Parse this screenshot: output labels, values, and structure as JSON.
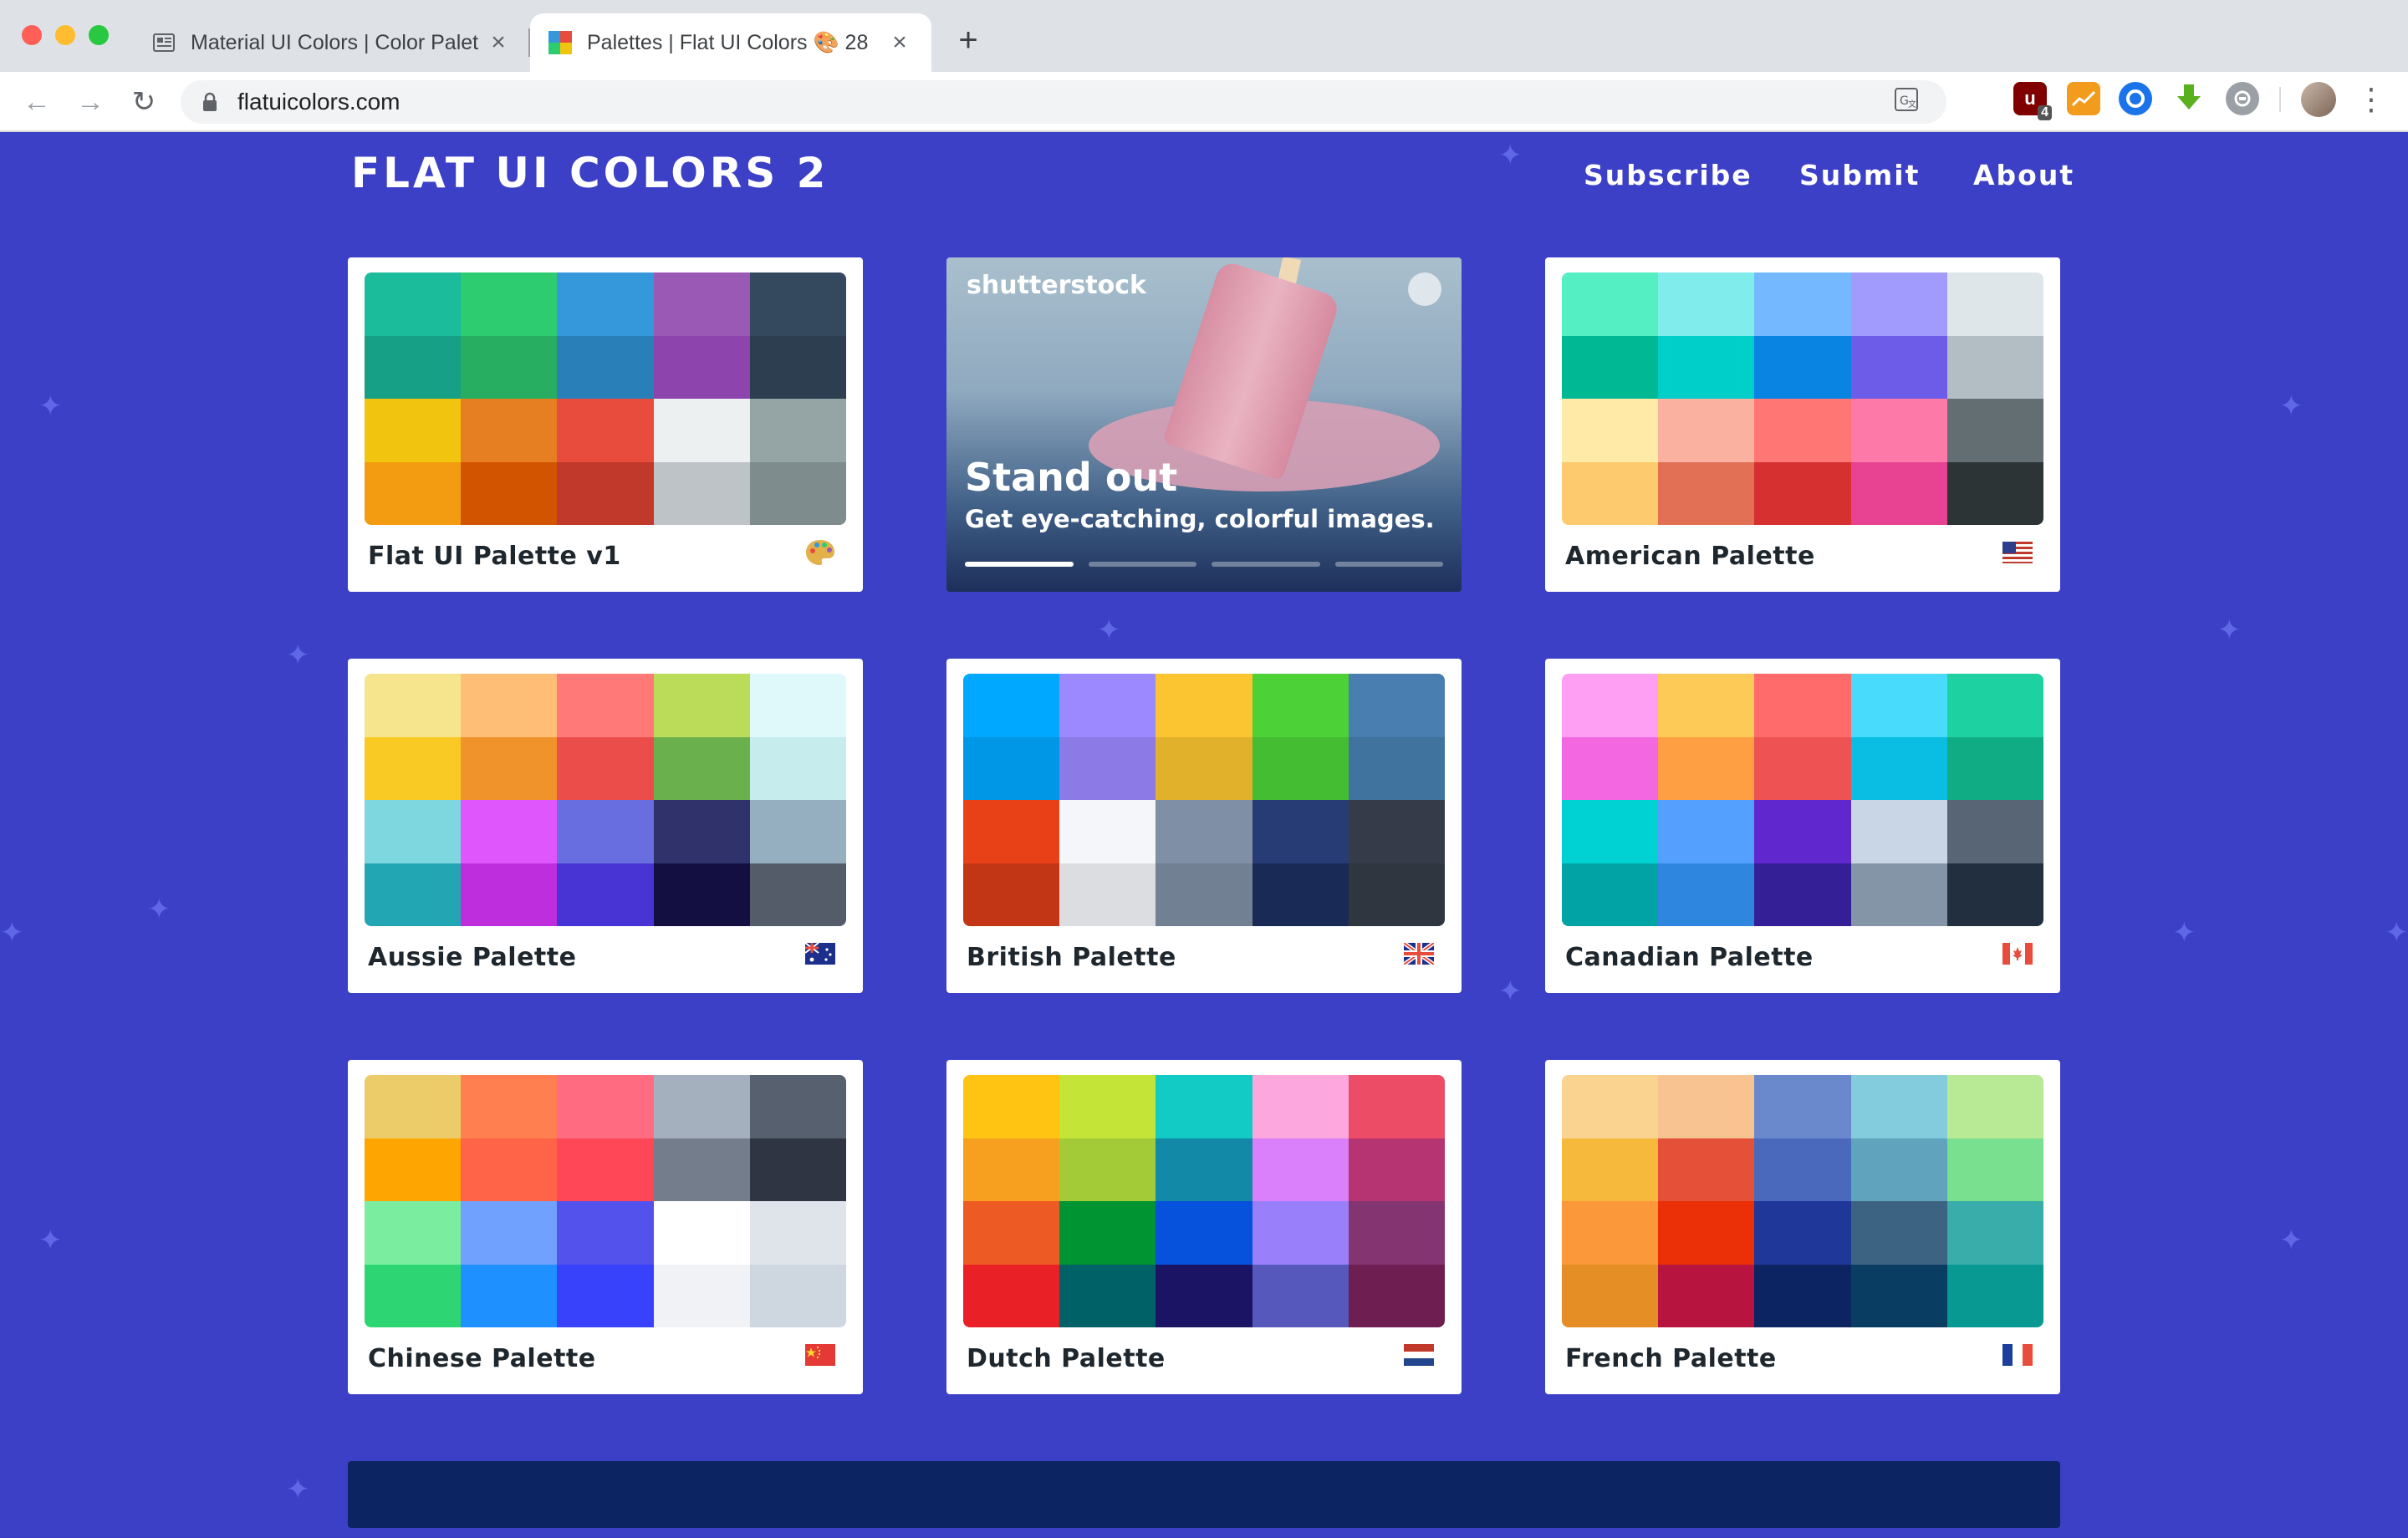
{
  "browser": {
    "tabs": [
      {
        "title": "Material UI Colors | Color Palet",
        "favicon": "newspaper-icon"
      },
      {
        "title": "Palettes | Flat UI Colors 🎨 28",
        "favicon": "colorful-grid-icon"
      }
    ],
    "url": "flatuicolors.com",
    "extensions": [
      {
        "name": "ublock-icon",
        "badge": "4"
      },
      {
        "name": "chart-extension-icon"
      },
      {
        "name": "blue-circle-extension-icon"
      },
      {
        "name": "download-arrow-icon"
      },
      {
        "name": "grey-circle-extension-icon"
      }
    ]
  },
  "header": {
    "brand": "FLAT UI COLORS 2",
    "nav": [
      "Subscribe",
      "Submit",
      "About"
    ]
  },
  "ad": {
    "logo": "shutterstock",
    "headline": "Stand out",
    "subline": "Get eye-catching, colorful images.",
    "slide_count": 4,
    "active_slide": 1
  },
  "palettes": [
    {
      "name": "Flat UI Palette v1",
      "emoji": "palette",
      "colors": [
        "#1abc9c",
        "#2ecc71",
        "#3498db",
        "#9b59b6",
        "#34495e",
        "#16a085",
        "#27ae60",
        "#2980b9",
        "#8e44ad",
        "#2c3e50",
        "#f1c40f",
        "#e67e22",
        "#e74c3c",
        "#ecf0f1",
        "#95a5a6",
        "#f39c12",
        "#d35400",
        "#c0392b",
        "#bdc3c7",
        "#7f8c8d"
      ]
    },
    {
      "name": "American Palette",
      "emoji": "flag-us",
      "colors": [
        "#55efc4",
        "#81ecec",
        "#74b9ff",
        "#a29bfe",
        "#dfe6e9",
        "#00b894",
        "#00cec9",
        "#0984e3",
        "#6c5ce7",
        "#b2bec3",
        "#ffeaa7",
        "#fab1a0",
        "#ff7675",
        "#fd79a8",
        "#636e72",
        "#fdcb6e",
        "#e17055",
        "#d63031",
        "#e84393",
        "#2d3436"
      ]
    },
    {
      "name": "Aussie Palette",
      "emoji": "flag-au",
      "colors": [
        "#f6e58d",
        "#ffbe76",
        "#ff7979",
        "#badc58",
        "#dff9fb",
        "#f9ca24",
        "#f0932b",
        "#eb4d4b",
        "#6ab04c",
        "#c7ecee",
        "#7ed6df",
        "#e056fd",
        "#686de0",
        "#30336b",
        "#95afc0",
        "#22a6b3",
        "#be2edd",
        "#4834d4",
        "#130f40",
        "#535c68"
      ]
    },
    {
      "name": "British Palette",
      "emoji": "flag-gb",
      "colors": [
        "#00a8ff",
        "#9c88ff",
        "#fbc531",
        "#4cd137",
        "#487eb0",
        "#0097e6",
        "#8c7ae6",
        "#e1b12c",
        "#44bd32",
        "#40739e",
        "#e84118",
        "#f5f6fa",
        "#7f8fa6",
        "#273c75",
        "#353b48",
        "#c23616",
        "#dcdde1",
        "#718093",
        "#192a56",
        "#2f3640"
      ]
    },
    {
      "name": "Canadian Palette",
      "emoji": "flag-ca",
      "colors": [
        "#ff9ff3",
        "#feca57",
        "#ff6b6b",
        "#48dbfb",
        "#1dd1a1",
        "#f368e0",
        "#ff9f43",
        "#ee5253",
        "#0abde3",
        "#10ac84",
        "#00d2d3",
        "#54a0ff",
        "#5f27cd",
        "#c8d6e5",
        "#576574",
        "#01a3a4",
        "#2e86de",
        "#341f97",
        "#8395a7",
        "#222f3e"
      ]
    },
    {
      "name": "Chinese Palette",
      "emoji": "flag-cn",
      "colors": [
        "#eccc68",
        "#ff7f50",
        "#ff6b81",
        "#a4b0be",
        "#57606f",
        "#ffa502",
        "#ff6348",
        "#ff4757",
        "#747d8c",
        "#2f3542",
        "#7bed9f",
        "#70a1ff",
        "#5352ed",
        "#ffffff",
        "#dfe4ea",
        "#2ed573",
        "#1e90ff",
        "#3742fa",
        "#f1f2f6",
        "#ced6e0"
      ]
    },
    {
      "name": "Dutch Palette",
      "emoji": "flag-nl",
      "colors": [
        "#ffc312",
        "#c4e538",
        "#12cbc4",
        "#fda7df",
        "#ed4c67",
        "#f79f1f",
        "#a3cb38",
        "#1289a7",
        "#d980fa",
        "#b53471",
        "#ee5a24",
        "#009432",
        "#0652dd",
        "#9980fa",
        "#833471",
        "#ea2027",
        "#006266",
        "#1b1464",
        "#5758bb",
        "#6f1e51"
      ]
    },
    {
      "name": "French Palette",
      "emoji": "flag-fr",
      "colors": [
        "#fad390",
        "#f8c291",
        "#6a89cc",
        "#82ccdd",
        "#b8e994",
        "#f6b93b",
        "#e55039",
        "#4a69bd",
        "#60a3bc",
        "#78e08f",
        "#fa983a",
        "#eb2f06",
        "#1e3799",
        "#3c6382",
        "#38ada9",
        "#e58e26",
        "#b71540",
        "#0c2461",
        "#0a3d62",
        "#079992"
      ]
    }
  ],
  "colors": {
    "page_background": "#3c40c6",
    "card_background": "#ffffff",
    "footer_bar": "#0c2461"
  }
}
